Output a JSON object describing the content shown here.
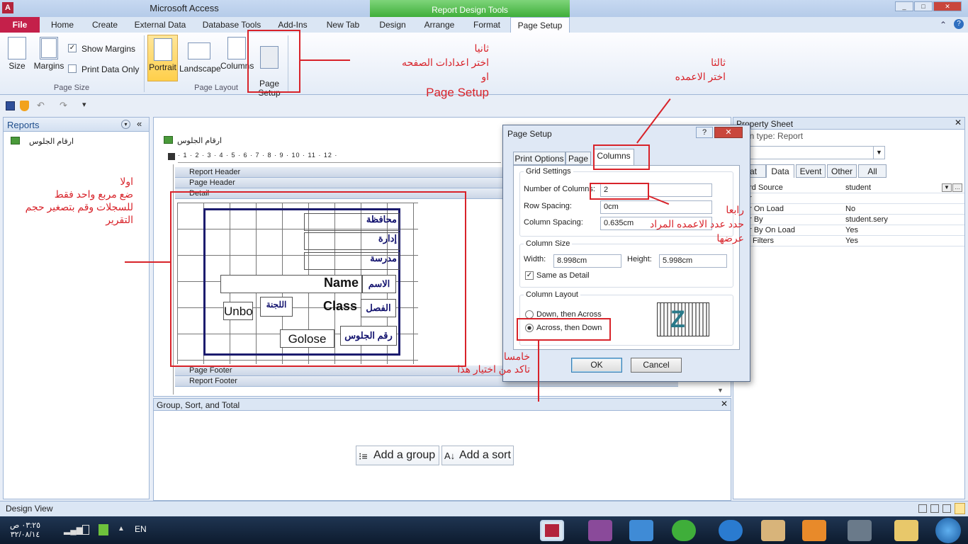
{
  "window": {
    "title": "Microsoft Access",
    "context_title": "Report Design Tools",
    "min": "_",
    "max": "□",
    "close": "✕"
  },
  "tabs": [
    "File",
    "Home",
    "Create",
    "External Data",
    "Database Tools",
    "Add-Ins",
    "New Tab",
    "Design",
    "Arrange",
    "Format",
    "Page Setup"
  ],
  "ribbon": {
    "size": "Size",
    "margins": "Margins",
    "show_margins": "Show Margins",
    "print_data_only": "Print Data Only",
    "group_page_size": "Page Size",
    "portrait": "Portrait",
    "landscape": "Landscape",
    "columns": "Columns",
    "page_setup": "Page\nSetup",
    "group_page_layout": "Page Layout"
  },
  "nav": {
    "title": "Reports",
    "item": "ارقام الجلوس"
  },
  "doc": {
    "title": "ارقام الجلوس",
    "bands": [
      "Report Header",
      "Page Header",
      "Detail",
      "Page Footer",
      "Report Footer"
    ],
    "controls": {
      "governorate": "محافظة",
      "administration": "إدارة",
      "school": "مدرسة",
      "name_label": "الاسم",
      "name_field": "Name",
      "class_label": "الفصل",
      "class_field": "Class",
      "committee": "اللجنة",
      "unbound": "Unbo",
      "seat_label": "رقم الجلوس",
      "golose": "Golose"
    },
    "ruler": "· 1 · 2 · 3 · 4 · 5 · 6 · 7 · 8 · 9 · 10 · 11 · 12 ·"
  },
  "group_pane": {
    "title": "Group, Sort, and Total",
    "add_group": "Add a group",
    "add_sort": "Add a sort"
  },
  "prop": {
    "title": "Property Sheet",
    "selection": "ction type:  Report",
    "combo": "ort",
    "tabs": [
      "mat",
      "Data",
      "Event",
      "Other",
      "All"
    ],
    "rows": [
      [
        "ord Source",
        "student"
      ],
      [
        "er",
        ""
      ],
      [
        "er On Load",
        "No"
      ],
      [
        "er By",
        "student.sery"
      ],
      [
        "er By On Load",
        "Yes"
      ],
      [
        "w Filters",
        "Yes"
      ]
    ]
  },
  "dialog": {
    "title": "Page Setup",
    "help": "?",
    "close": "✕",
    "tabs": [
      "Print Options",
      "Page",
      "Columns"
    ],
    "grid_settings": "Grid Settings",
    "num_columns_label": "Number of Columns:",
    "num_columns": "2",
    "row_spacing_label": "Row Spacing:",
    "row_spacing": "0cm",
    "col_spacing_label": "Column Spacing:",
    "col_spacing": "0.635cm",
    "column_size": "Column Size",
    "width_label": "Width:",
    "width": "8.998cm",
    "height_label": "Height:",
    "height": "5.998cm",
    "same_as_detail": "Same as Detail",
    "column_layout": "Column Layout",
    "down_across": "Down, then Across",
    "across_down": "Across, then Down",
    "ok": "OK",
    "cancel": "Cancel"
  },
  "annotations": {
    "a1": "اولا\nضع مربع واحد فقط\nللسجلات وقم بتصغير حجم\nالتقرير",
    "a2": "ثانيا\nاختر اعدادات الصفحه\nاو",
    "a2b": "Page Setup",
    "a3": "ثالثا\nاختر الاعمده",
    "a4": "رابعا\nحدد عدد الاعمده المراد\nعرضها",
    "a5": "خامسا\nتاكد من اختيار هذا"
  },
  "status": {
    "left": "Design View"
  },
  "taskbar": {
    "lang": "EN",
    "time": "٠٣:٢٥ ص",
    "date": "٣٢/٠٨/١٤"
  },
  "colors": {
    "annotation": "#d8232a",
    "file_tab": "#c4204a",
    "context": "#3fae3a"
  }
}
